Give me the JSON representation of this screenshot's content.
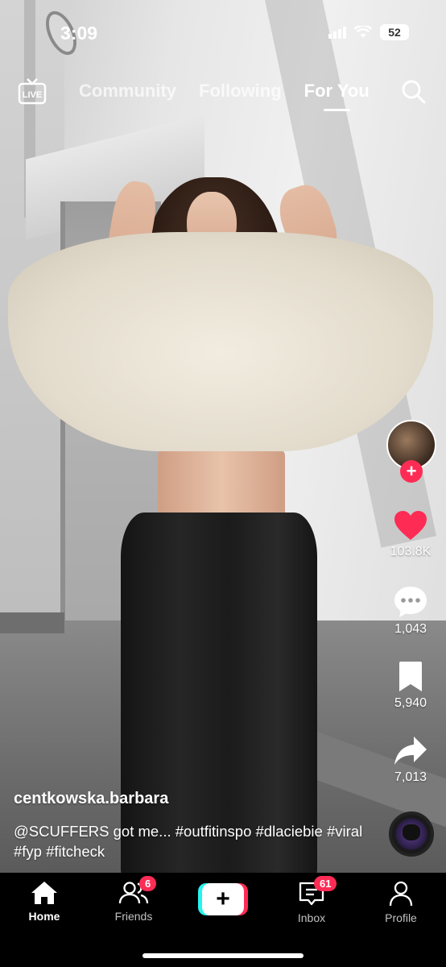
{
  "status_bar": {
    "time": "3:09",
    "battery": "52"
  },
  "top_nav": {
    "live_label": "LIVE",
    "tabs": [
      {
        "label": "Community",
        "active": false
      },
      {
        "label": "Following",
        "active": false
      },
      {
        "label": "For You",
        "active": true
      }
    ]
  },
  "rail": {
    "likes": "103.8K",
    "comments": "1,043",
    "saves": "5,940",
    "shares": "7,013",
    "follow_symbol": "+"
  },
  "post": {
    "username": "centkowska.barbara",
    "caption_mention": "@SCUFFERS",
    "caption_text": " got me... ",
    "caption_tags": "#outfitinspo #dlaciebie #viral #fyp #fitcheck"
  },
  "tabbar": {
    "home": "Home",
    "friends": "Friends",
    "friends_badge": "6",
    "create_symbol": "+",
    "inbox": "Inbox",
    "inbox_badge": "61",
    "profile": "Profile"
  },
  "colors": {
    "accent": "#fe2c55",
    "cyan": "#25f4ee",
    "like": "#fe2c55"
  }
}
